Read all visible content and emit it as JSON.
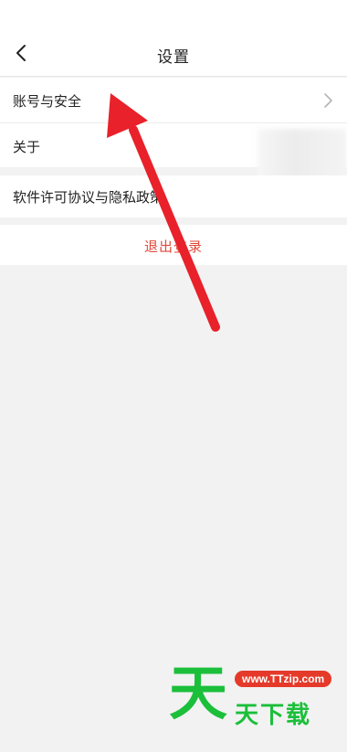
{
  "header": {
    "title": "设置"
  },
  "settings": {
    "account_security": "账号与安全",
    "about": "关于",
    "license_privacy": "软件许可协议与隐私政策",
    "logout": "退出登录"
  },
  "watermark": {
    "big_char": "天",
    "url": "www.TTzip.com",
    "text": "天下载"
  },
  "colors": {
    "logout_text": "#e04a3a",
    "arrow": "#e8212a",
    "watermark_green": "#1bbf3a",
    "watermark_badge": "#e53a2a"
  }
}
